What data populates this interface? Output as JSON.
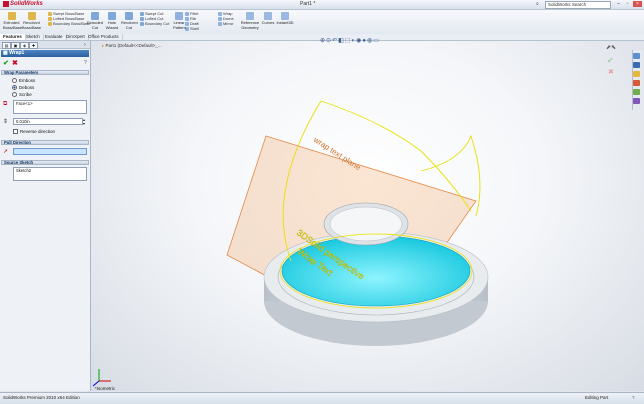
{
  "app": {
    "name": "SolidWorks",
    "document_title": "Part1 *"
  },
  "search": {
    "placeholder": "SolidWorks Search"
  },
  "ribbon": {
    "large_buttons": [
      {
        "label": "Extruded Boss/Base",
        "color": "#e0b54b"
      },
      {
        "label": "Revolved Boss/Base",
        "color": "#e0b54b"
      },
      {
        "label": "Extruded Cut",
        "color": "#7fa8d8"
      },
      {
        "label": "Hole Wizard",
        "color": "#7fa8d8"
      },
      {
        "label": "Revolved Cut",
        "color": "#7fa8d8"
      },
      {
        "label": "Linear Pattern",
        "color": "#8fb2de"
      },
      {
        "label": "Reference Geometry",
        "color": "#9bb9e0"
      },
      {
        "label": "Curves",
        "color": "#9bb9e0"
      },
      {
        "label": "Instant3D",
        "color": "#9bb9e0"
      }
    ],
    "small_group1": [
      "Swept Boss/Base",
      "Lofted Boss/Base",
      "Boundary Boss/Base"
    ],
    "small_group2": [
      "Swept Cut",
      "Lofted Cut",
      "Boundary Cut"
    ],
    "small_group3": [
      "Fillet",
      "Rib",
      "Draft",
      "Shell"
    ],
    "small_group4": [
      "Wrap",
      "Dome",
      "Mirror"
    ]
  },
  "command_tabs": [
    "Features",
    "Sketch",
    "Evaluate",
    "DimXpert",
    "Office Products"
  ],
  "panel": {
    "title": "Wrap1",
    "wrap_parameters": {
      "header": "Wrap Parameters",
      "options": [
        "Emboss",
        "Deboss",
        "Scribe"
      ],
      "selected": "Deboss",
      "face_value": "Face<1>",
      "depth_value": "0.010in",
      "reverse_label": "Reverse direction"
    },
    "pull_direction": {
      "header": "Pull Direction"
    },
    "source_sketch": {
      "header": "Source Sketch",
      "value": "Sketch2"
    }
  },
  "viewport": {
    "breadcrumb": "Part1 (Default<<Default>_...",
    "view_label": "*Isometric",
    "plane_label": "wrap text plane",
    "embossed_text": [
      "3DSolid perspective",
      "Wrap Text"
    ],
    "colors": {
      "face": "#20d2e6",
      "plane_edge": "#e8e000",
      "plane_fill": "#f2a062",
      "axis_x": "#d00000",
      "axis_y": "#00a000",
      "axis_z": "#0000d0"
    }
  },
  "statusbar": {
    "left": "SolidWorks Premium 2010 x64 Edition",
    "right": "Editing Part"
  }
}
